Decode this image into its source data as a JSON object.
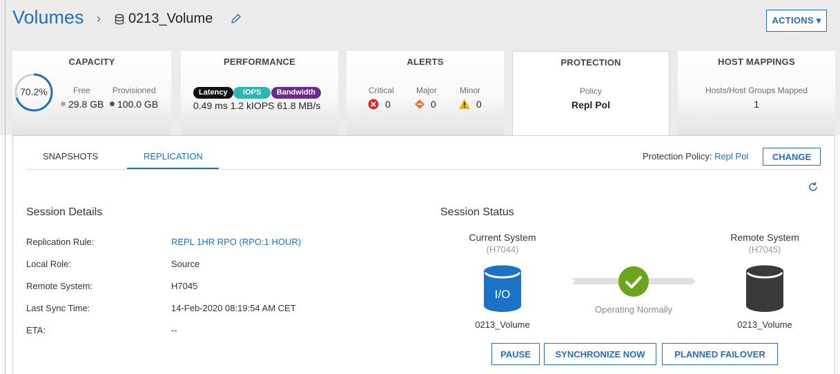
{
  "breadcrumb": {
    "root": "Volumes",
    "separator": "›",
    "current": "0213_Volume"
  },
  "header": {
    "actions_label": "ACTIONS ▾"
  },
  "cards": {
    "capacity": {
      "title": "CAPACITY",
      "percent": "70.2%",
      "percent_value": 0.702,
      "free_label": "Free",
      "free_value": "29.8 GB",
      "provisioned_label": "Provisioned",
      "provisioned_value": "100.0 GB"
    },
    "performance": {
      "title": "PERFORMANCE",
      "latency_label": "Latency",
      "iops_label": "IOPS",
      "bandwidth_label": "Bandwidth",
      "values": "0.49 ms 1.2 kIOPS 61.8 MB/s"
    },
    "alerts": {
      "title": "ALERTS",
      "critical_label": "Critical",
      "critical_value": "0",
      "major_label": "Major",
      "major_value": "0",
      "minor_label": "Minor",
      "minor_value": "0"
    },
    "protection": {
      "title": "PROTECTION",
      "policy_label": "Policy",
      "policy_value": "Repl Pol"
    },
    "host_mappings": {
      "title": "HOST MAPPINGS",
      "label": "Hosts/Host Groups Mapped",
      "value": "1"
    }
  },
  "tabs": [
    {
      "label": "SNAPSHOTS"
    },
    {
      "label": "REPLICATION"
    }
  ],
  "protection_policy": {
    "label": "Protection Policy:",
    "value": "Repl Pol",
    "change_label": "CHANGE"
  },
  "session_details": {
    "title": "Session Details",
    "rows": [
      {
        "label": "Replication Rule:",
        "value": "REPL 1HR RPO (RPO:1 HOUR)"
      },
      {
        "label": "Local Role:",
        "value": "Source"
      },
      {
        "label": "Remote System:",
        "value": "H7045"
      },
      {
        "label": "Last Sync Time:",
        "value": "14-Feb-2020 08:19:54 AM CET"
      },
      {
        "label": "ETA:",
        "value": "--"
      }
    ]
  },
  "session_status": {
    "title": "Session Status",
    "current": {
      "title": "Current System",
      "id": "(H7044)",
      "icon_text": "I/O",
      "volume": "0213_Volume"
    },
    "remote": {
      "title": "Remote System",
      "id": "(H7045)",
      "volume": "0213_Volume"
    },
    "status_text": "Operating Normally"
  },
  "buttons": {
    "pause": "PAUSE",
    "sync": "SYNCHRONIZE NOW",
    "failover": "PLANNED FAILOVER"
  },
  "colors": {
    "accent": "#1f6fbf",
    "capacity_ring": "#1f6fbf",
    "latency": "#111111",
    "iops": "#2bb5b5",
    "bandwidth": "#6d2a8c",
    "critical": "#d32f2f",
    "major": "#e8732c",
    "minor": "#f0b400",
    "ok": "#6aa51c",
    "local_db": "#1a73c8",
    "remote_db": "#3a3a3a"
  }
}
